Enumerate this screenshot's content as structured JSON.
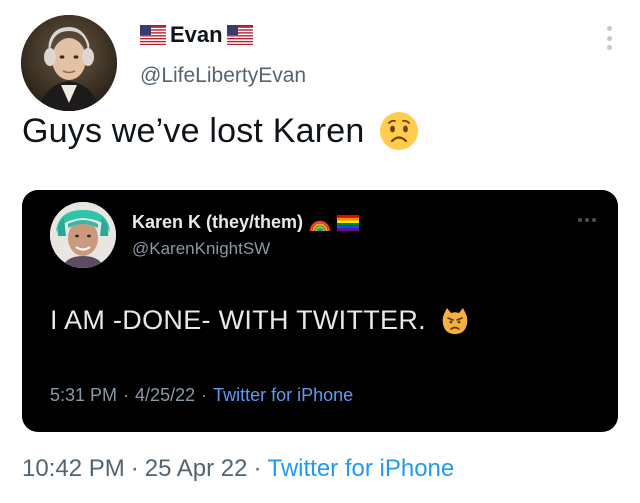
{
  "author": {
    "display_name": "Evan",
    "handle": "@LifeLibertyEvan",
    "flag_icon": "us-flag-icon"
  },
  "tweet": {
    "text": "Guys we’ve lost Karen",
    "emoji": "worried-face-icon",
    "time": "10:42 PM",
    "date": "25 Apr 22",
    "source": "Twitter for iPhone",
    "separator": "·"
  },
  "quoted_tweet": {
    "display_name": "Karen K (they/them)",
    "handle": "@KarenKnightSW",
    "name_icons": [
      "rainbow-icon",
      "rainbow-flag-icon"
    ],
    "text": "I AM -DONE- WITH TWITTER.",
    "emoji": "pouting-cat-icon",
    "time": "5:31 PM",
    "date": "4/25/22",
    "source": "Twitter for iPhone",
    "separator": "·"
  },
  "colors": {
    "link": "#1d9bf0",
    "secondary_text": "#536471",
    "quote_background": "#000000"
  }
}
